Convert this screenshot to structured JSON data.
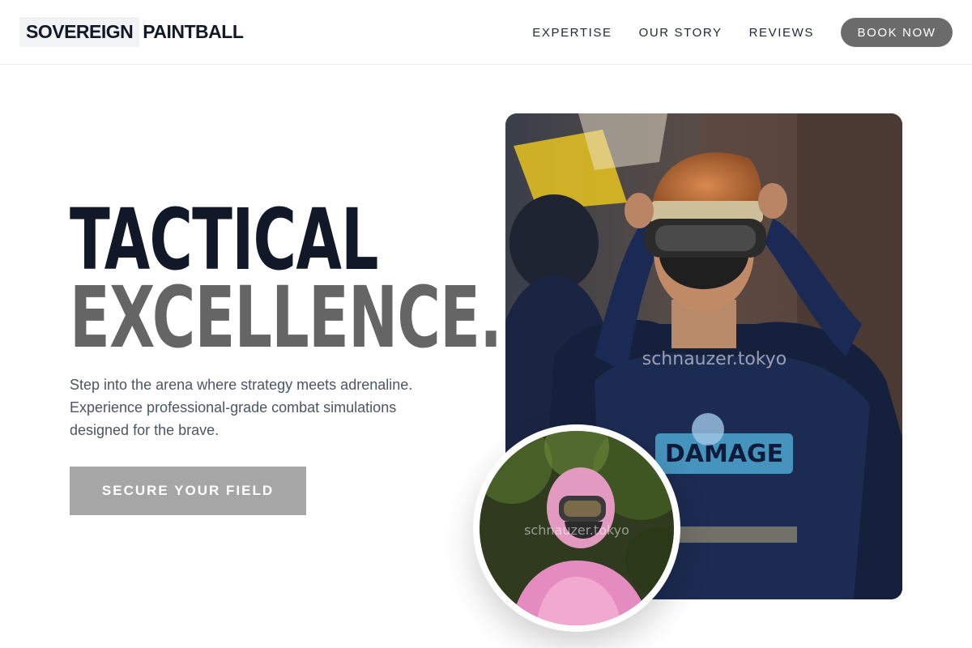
{
  "brand": {
    "part1": "SOVEREIGN",
    "part2": "PAINTBALL"
  },
  "nav": {
    "items": [
      {
        "label": "EXPERTISE"
      },
      {
        "label": "OUR STORY"
      },
      {
        "label": "REVIEWS"
      }
    ],
    "cta_label": "BOOK NOW"
  },
  "hero": {
    "headline_line1": "TACTICAL",
    "headline_line2": "EXCELLENCE.",
    "subtext": "Step into the arena where strategy meets adrenaline. Experience professional-grade combat simulations designed for the brave.",
    "cta_label": "SECURE YOUR FIELD"
  },
  "images": {
    "main_watermark": "schnauzer.tokyo",
    "circle_watermark": "schnauzer.tokyo"
  },
  "colors": {
    "headline_dark": "#111827",
    "headline_gray": "#656565",
    "book_button": "#6b6b6b",
    "cta_button": "#a6a6a6"
  }
}
